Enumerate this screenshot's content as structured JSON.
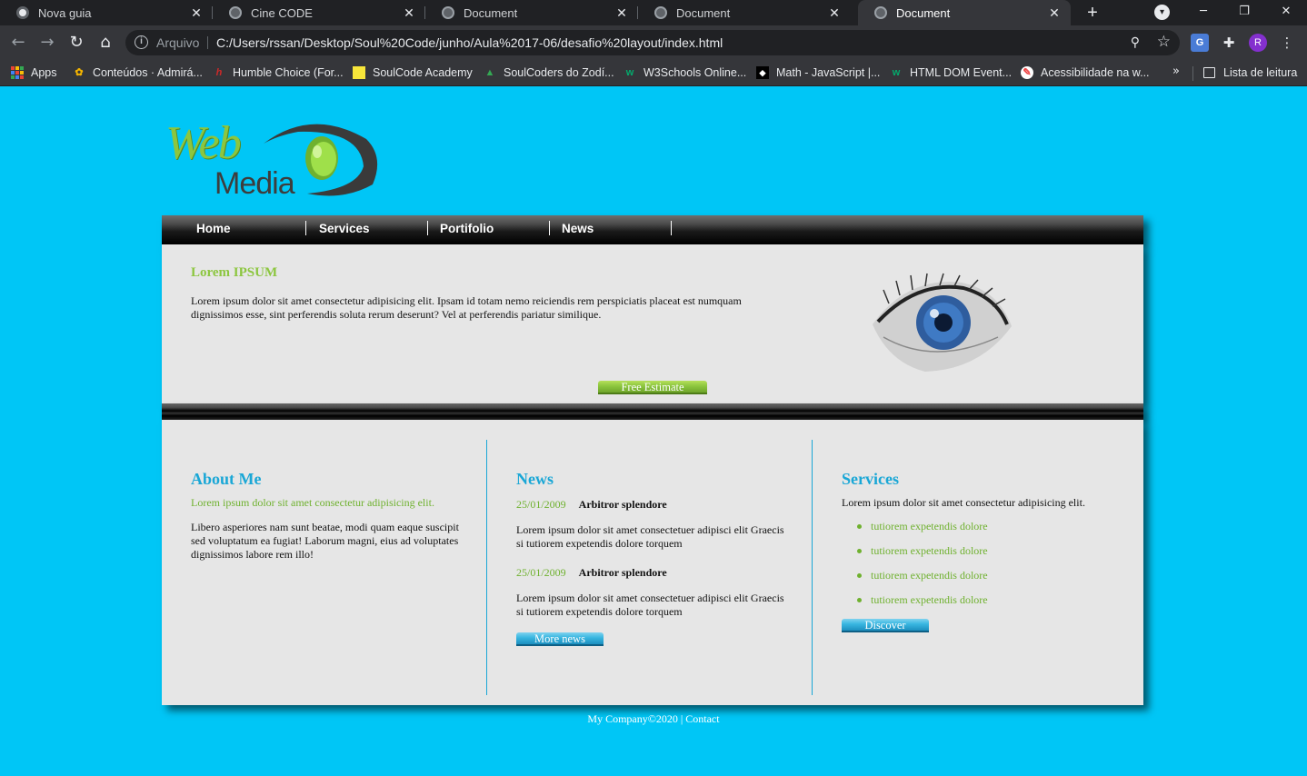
{
  "browser": {
    "tabs": [
      {
        "title": "Nova guia",
        "icon": "chrome-icon",
        "active": false
      },
      {
        "title": "Cine CODE",
        "icon": "globe-icon",
        "active": false
      },
      {
        "title": "Document",
        "icon": "globe-icon",
        "active": false
      },
      {
        "title": "Document",
        "icon": "globe-icon",
        "active": false
      },
      {
        "title": "Document",
        "icon": "globe-icon",
        "active": true
      }
    ],
    "address": {
      "scheme_label": "Arquivo",
      "url": "C:/Users/rssan/Desktop/Soul%20Code/junho/Aula%2017-06/desafio%20layout/index.html"
    },
    "profile_initial": "R",
    "bookmarks": [
      {
        "label": "Apps",
        "icon": "apps-grid-icon"
      },
      {
        "label": "Conteúdos · Admirá...",
        "icon": "flower-icon"
      },
      {
        "label": "Humble Choice (For...",
        "icon": "humble-icon"
      },
      {
        "label": "SoulCode Academy",
        "icon": "soulcode-icon"
      },
      {
        "label": "SoulCoders do Zodí...",
        "icon": "drive-icon"
      },
      {
        "label": "W3Schools Online...",
        "icon": "w3schools-icon"
      },
      {
        "label": "Math - JavaScript |...",
        "icon": "mdn-icon"
      },
      {
        "label": "HTML DOM Event...",
        "icon": "w3schools-icon"
      },
      {
        "label": "Acessibilidade na w...",
        "icon": "accessibility-icon"
      }
    ],
    "reading_list": "Lista de leitura"
  },
  "site": {
    "logo": {
      "word1": "Web",
      "word2": "Media"
    },
    "nav": [
      "Home",
      "Services",
      "Portifolio",
      "News"
    ],
    "hero": {
      "title": "Lorem IPSUM",
      "text": "Lorem ipsum dolor sit amet consectetur adipisicing elit. Ipsam id totam nemo reiciendis rem perspiciatis placeat est numquam dignissimos esse, sint perferendis soluta rerum deserunt? Vel at perferendis pariatur similique.",
      "button": "Free Estimate"
    },
    "about": {
      "title": "About Me",
      "subtitle": "Lorem ipsum dolor sit amet consectetur adipisicing elit.",
      "text": "Libero asperiores nam sunt beatae, modi quam eaque suscipit sed voluptatum ea fugiat! Laborum magni, eius ad voluptates dignissimos labore rem illo!"
    },
    "news": {
      "title": "News",
      "items": [
        {
          "date": "25/01/2009",
          "headline": "Arbitror splendore",
          "text": "Lorem ipsum dolor sit amet consectetuer adipisci elit Graecis si tutiorem expetendis dolore torquem"
        },
        {
          "date": "25/01/2009",
          "headline": "Arbitror splendore",
          "text": "Lorem ipsum dolor sit amet consectetuer adipisci elit Graecis si tutiorem expetendis dolore torquem"
        }
      ],
      "button": "More news"
    },
    "services": {
      "title": "Services",
      "intro": "Lorem ipsum dolor sit amet consectetur adipisicing elit.",
      "items": [
        "tutiorem expetendis dolore",
        "tutiorem expetendis dolore",
        "tutiorem expetendis dolore",
        "tutiorem expetendis dolore"
      ],
      "button": "Discover"
    },
    "footer": {
      "company": "My Company©2020",
      "separator": " | ",
      "contact": "Contact"
    }
  },
  "colors": {
    "page_bg": "#00c6f6",
    "accent_green": "#8cc63f",
    "accent_blue": "#1aa7d6",
    "panel": "#e6e6e6"
  }
}
